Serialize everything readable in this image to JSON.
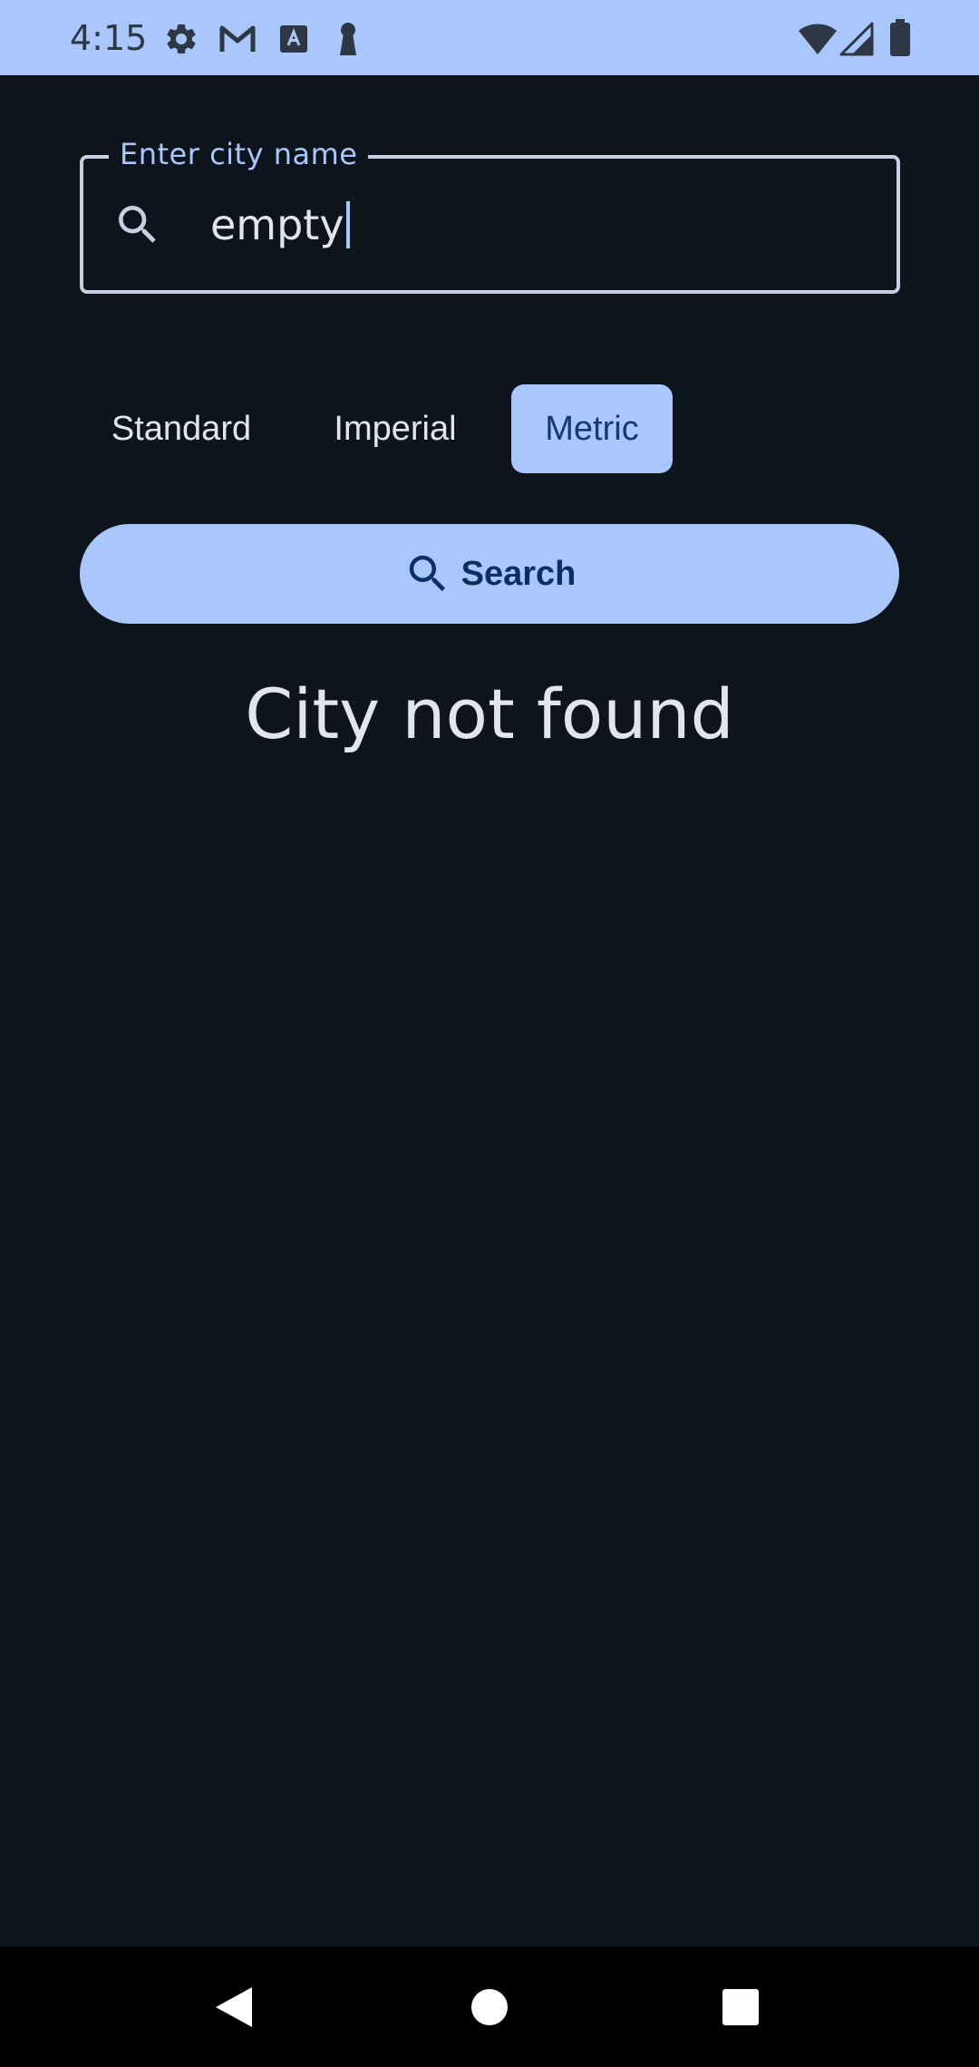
{
  "status_bar": {
    "time": "4:15",
    "left_icons": [
      "settings-icon",
      "gmail-icon",
      "font-icon",
      "keyhole-icon"
    ],
    "right_icons": [
      "wifi-icon",
      "signal-icon",
      "battery-icon"
    ]
  },
  "search_field": {
    "label": "Enter city name",
    "value": "empty",
    "icon": "search-icon"
  },
  "units": {
    "options": [
      "Standard",
      "Imperial",
      "Metric"
    ],
    "selected": "Metric"
  },
  "search_button": {
    "label": "Search",
    "icon": "search-icon"
  },
  "result": {
    "message": "City not found"
  },
  "nav_bar": {
    "buttons": [
      "back-icon",
      "home-icon",
      "recents-icon"
    ]
  },
  "colors": {
    "background": "#0e141c",
    "accent": "#a9c7fb",
    "on_accent": "#0d2f5f",
    "text": "#e2e5ef",
    "field_border": "#c9cfe2"
  }
}
